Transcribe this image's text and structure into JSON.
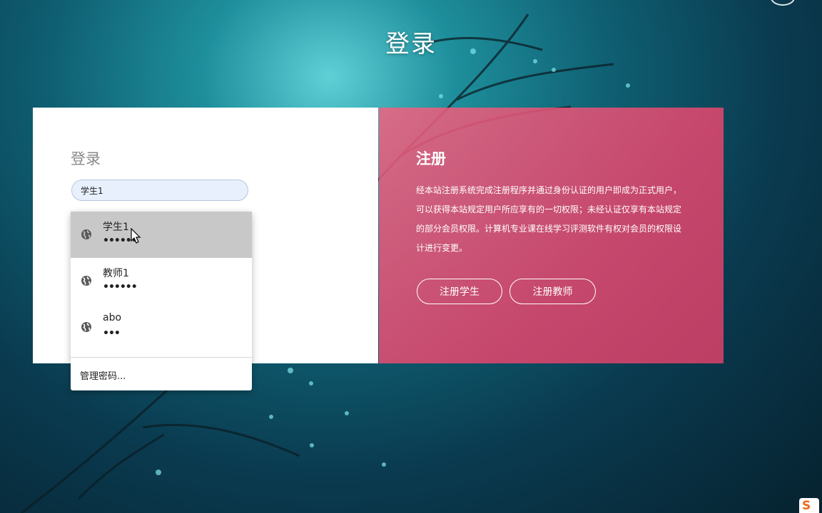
{
  "header": {
    "title": "登录"
  },
  "login": {
    "heading": "登录",
    "username_value": "学生1"
  },
  "autofill": {
    "items": [
      {
        "username": "学生1",
        "password_mask": "••••••",
        "icon": "globe-icon",
        "selected": true
      },
      {
        "username": "教师1",
        "password_mask": "••••••",
        "icon": "globe-icon",
        "selected": false
      },
      {
        "username": "abo",
        "password_mask": "•••",
        "icon": "globe-icon",
        "selected": false
      }
    ],
    "manage_label": "管理密码..."
  },
  "register": {
    "heading": "注册",
    "description": "经本站注册系统完成注册程序并通过身份认证的用户即成为正式用户，可以获得本站规定用户所应享有的一切权限；未经认证仅享有本站规定的部分会员权限。计算机专业课在线学习评测软件有权对会员的权限设计进行变更。",
    "student_button": "注册学生",
    "teacher_button": "注册教师"
  },
  "taskbar": {
    "ime_icon": "sogou-ime-icon",
    "ime_letter": "S"
  },
  "colors": {
    "accent_pink": "#e8506f",
    "selected_row": "#c8c8c8",
    "input_fill": "#e8f0fe"
  }
}
